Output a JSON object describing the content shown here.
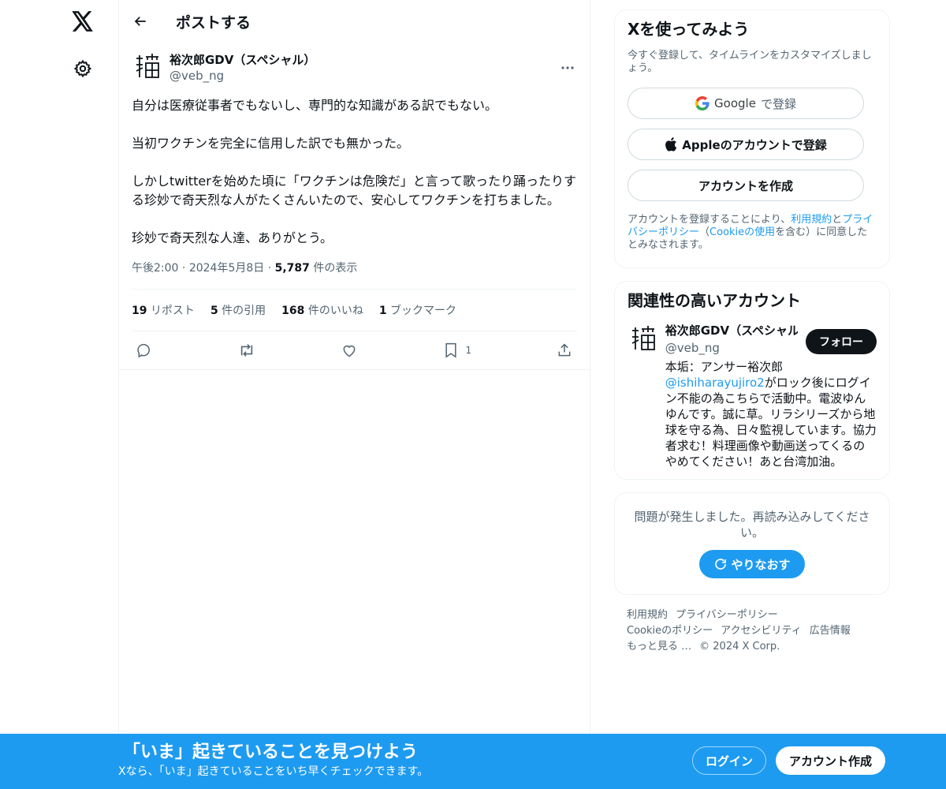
{
  "colors": {
    "accent": "#1d9bf0",
    "text": "#0f1419",
    "muted": "#536471",
    "border": "#eff3f4"
  },
  "nav": {
    "logo_icon": "x-logo-icon",
    "settings_icon": "gear-icon"
  },
  "header": {
    "title": "ポストする"
  },
  "post": {
    "author_name": "裕次郎GDV（スペシャル）",
    "author_handle": "@veb_ng",
    "paragraphs": [
      "自分は医療従事者でもないし、専門的な知識がある訳でもない。",
      "当初ワクチンを完全に信用した訳でも無かった。",
      "しかしtwitterを始めた頃に「ワクチンは危険だ」と言って歌ったり踊ったりする珍妙で奇天烈な人がたくさんいたので、安心してワクチンを打ちました。",
      "珍妙で奇天烈な人達、ありがとう。"
    ],
    "time": "午後2:00",
    "date": "2024年5月8日",
    "views_count": "5,787",
    "views_label": "件の表示",
    "stats": {
      "reposts_count": "19",
      "reposts_label": "リポスト",
      "quotes_count": "5",
      "quotes_label": "件の引用",
      "likes_count": "168",
      "likes_label": "件のいいね",
      "bookmarks_count": "1",
      "bookmarks_label": "ブックマーク"
    },
    "bookmark_action_count": "1"
  },
  "signup_card": {
    "title": "Xを使ってみよう",
    "subtitle": "今すぐ登録して、タイムラインをカスタマイズしましょう。",
    "google_brand": "Google",
    "google_suffix": "で登録",
    "apple_label": "Appleのアカウントで登録",
    "create_label": "アカウントを作成",
    "legal_prefix": "アカウントを登録することにより、",
    "legal_terms": "利用規約",
    "legal_and": "と",
    "legal_privacy": "プライバシーポリシー",
    "legal_paren_open": "（",
    "legal_cookie": "Cookieの使用",
    "legal_suffix": "を含む）に同意したとみなされます。"
  },
  "related_card": {
    "title": "関連性の高いアカウント",
    "name": "裕次郎GDV（スペシャル）",
    "handle": "@veb_ng",
    "follow_label": "フォロー",
    "bio_prefix": "本垢：アンサー裕次郎",
    "bio_mention": "@ishiharayujiro2",
    "bio_suffix": "がロック後にログイン不能の為こちらで活動中。電波ゆんゆんです。誠に草。リラシリーズから地球を守る為、日々監視しています。協力者求む！料理画像や動画送ってくるのやめてください！あと台湾加油。"
  },
  "error_card": {
    "message": "問題が発生しました。再読み込みしてください。",
    "retry_label": "やりなおす"
  },
  "footer": {
    "links": [
      "利用規約",
      "プライバシーポリシー",
      "Cookieのポリシー",
      "アクセシビリティ",
      "広告情報",
      "もっと見る …"
    ],
    "copyright": "© 2024 X Corp."
  },
  "bottom_bar": {
    "title": "「いま」起きていることを見つけよう",
    "subtitle": "Xなら、「いま」起きていることをいち早くチェックできます。",
    "login_label": "ログイン",
    "signup_label": "アカウント作成"
  }
}
